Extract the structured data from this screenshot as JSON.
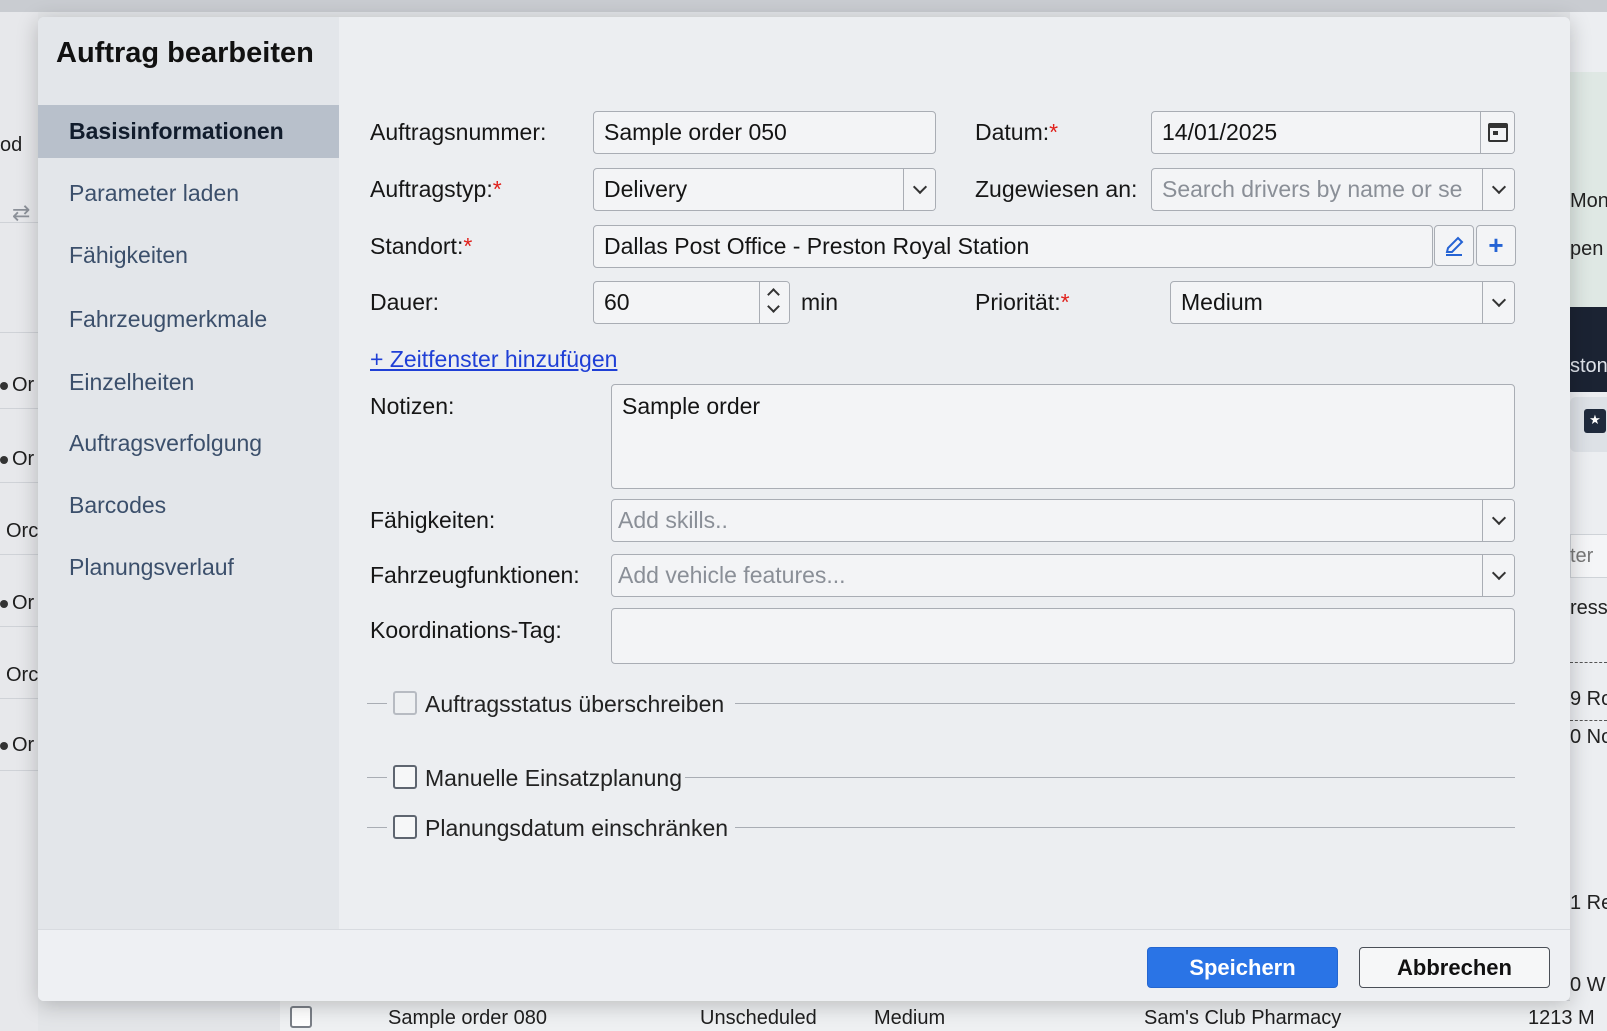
{
  "modal": {
    "title": "Auftrag bearbeiten",
    "nav": [
      {
        "label": "Basisinformationen",
        "active": true
      },
      {
        "label": "Parameter laden"
      },
      {
        "label": "Fähigkeiten"
      },
      {
        "label": "Fahrzeugmerkmale"
      },
      {
        "label": "Einzelheiten"
      },
      {
        "label": "Auftragsverfolgung"
      },
      {
        "label": "Barcodes"
      },
      {
        "label": "Planungsverlauf"
      }
    ],
    "form": {
      "order_number": {
        "label": "Auftragsnummer:",
        "value": "Sample order 050"
      },
      "date": {
        "label": "Datum:",
        "required_mark": "*",
        "value": "14/01/2025"
      },
      "order_type": {
        "label": "Auftragstyp:",
        "required_mark": "*",
        "value": "Delivery"
      },
      "assigned_to": {
        "label": "Zugewiesen an:",
        "placeholder": "Search drivers by name or se"
      },
      "location": {
        "label": "Standort:",
        "required_mark": "*",
        "value": "Dallas Post Office - Preston Royal Station"
      },
      "duration": {
        "label": "Dauer:",
        "value": "60",
        "unit": "min"
      },
      "priority": {
        "label": "Priorität:",
        "required_mark": "*",
        "value": "Medium"
      },
      "add_time_window": "+ Zeitfenster hinzufügen",
      "notes": {
        "label": "Notizen:",
        "value": "Sample order"
      },
      "skills": {
        "label": "Fähigkeiten:",
        "placeholder": "Add skills.."
      },
      "vehicle_features": {
        "label": "Fahrzeugfunktionen:",
        "placeholder": "Add vehicle features..."
      },
      "coordination_tag": {
        "label": "Koordinations-Tag:",
        "value": ""
      },
      "override_status": {
        "label": "Auftragsstatus überschreiben",
        "checked": false,
        "disabled": true
      },
      "manual_scheduling": {
        "label": "Manuelle Einsatzplanung",
        "checked": false
      },
      "restrict_planning_date": {
        "label": "Planungsdatum einschränken",
        "checked": false
      }
    },
    "footer": {
      "save": "Speichern",
      "cancel": "Abbrechen"
    }
  },
  "background": {
    "left_texts": [
      "od",
      "Or",
      "Or",
      "Orc",
      "Or",
      "Orc",
      "Or"
    ],
    "right_texts": [
      "Mont",
      "pen",
      "ston",
      "ter",
      "ress",
      "9 Ro",
      "0 No",
      "1 Re",
      "0 W"
    ],
    "bottom_row": {
      "order": "Sample order 080",
      "status": "Unscheduled",
      "priority": "Medium",
      "location": "Sam's Club Pharmacy",
      "address": "1213 M"
    }
  },
  "colors": {
    "primary": "#2a74e6",
    "required": "#e0201b",
    "link": "#1f3fd6",
    "active_nav": "#b8c0cb"
  }
}
